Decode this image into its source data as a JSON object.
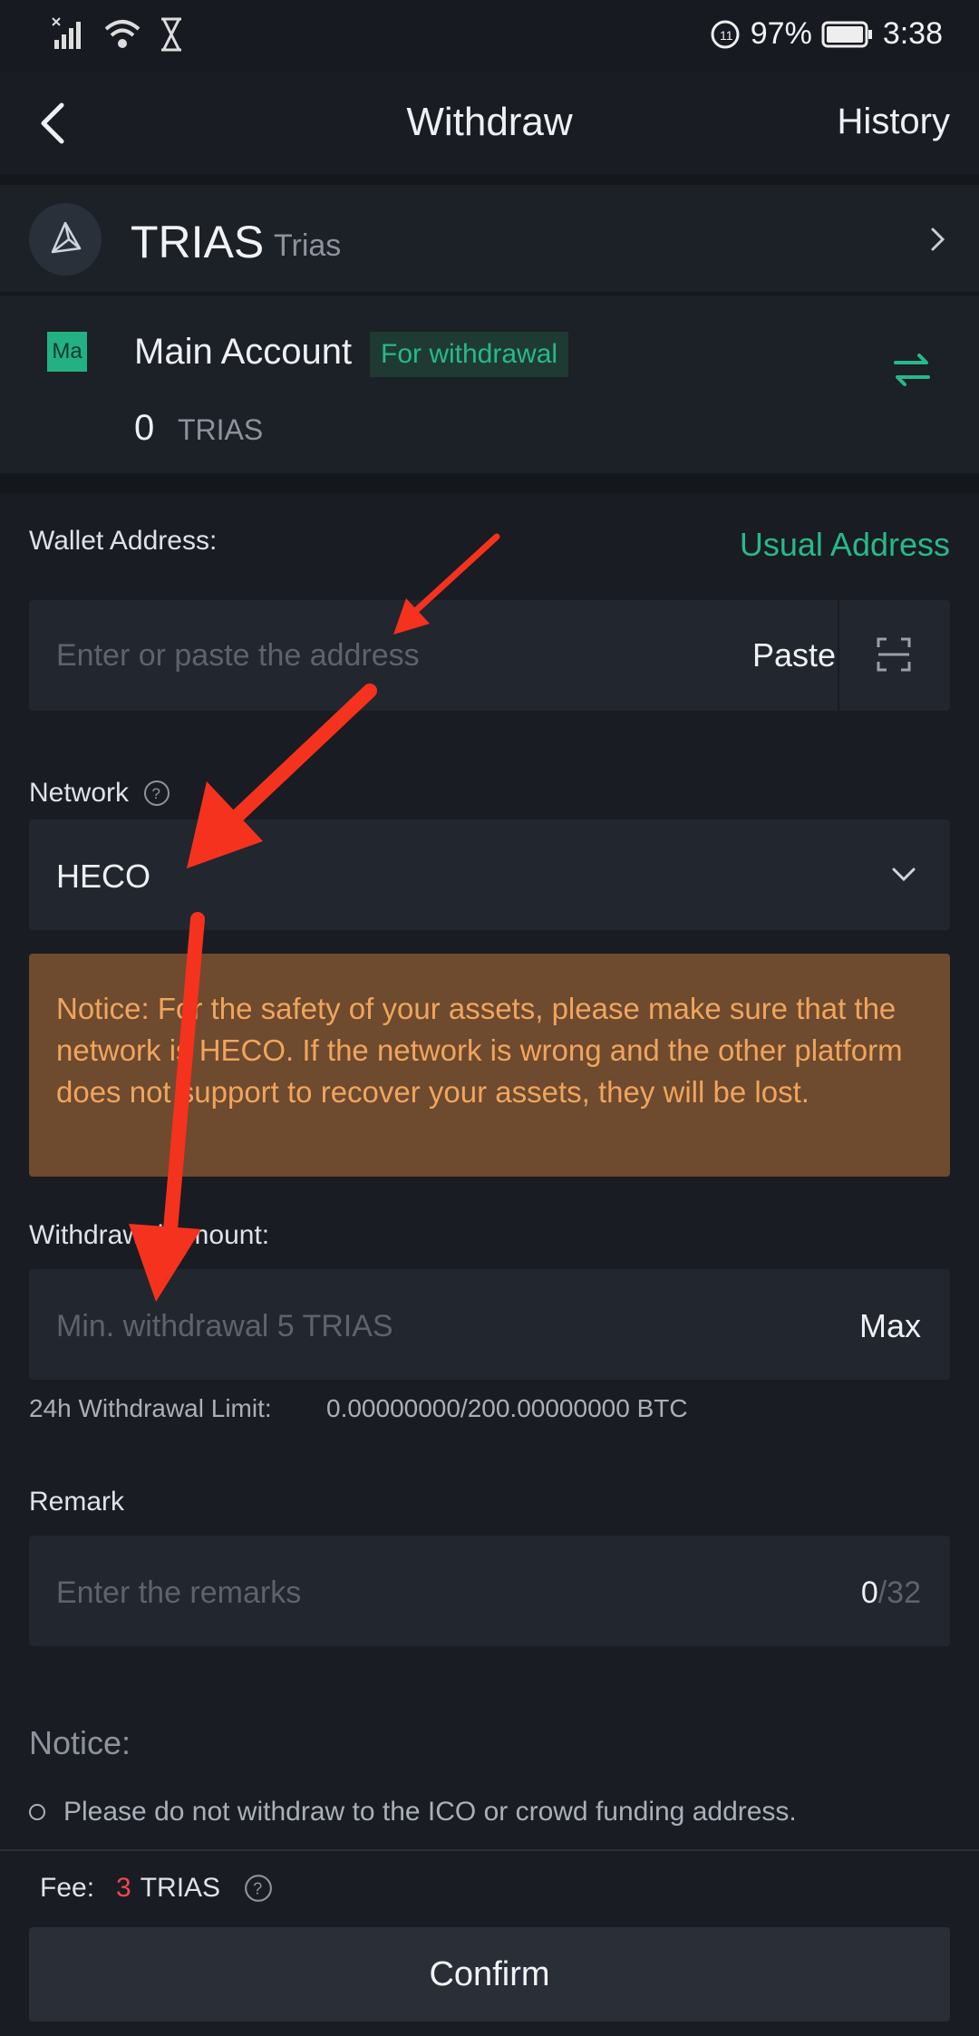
{
  "status_bar": {
    "battery": "97%",
    "time": "3:38"
  },
  "header": {
    "title": "Withdraw",
    "history": "History"
  },
  "coin": {
    "symbol": "TRIAS",
    "name": "Trias"
  },
  "account": {
    "badge": "Ma",
    "name": "Main Account",
    "tag": "For withdrawal",
    "balance": "0",
    "unit": "TRIAS"
  },
  "address": {
    "label": "Wallet Address:",
    "usual": "Usual Address",
    "placeholder": "Enter or paste the address",
    "paste": "Paste"
  },
  "network": {
    "label": "Network",
    "value": "HECO"
  },
  "notice_box": {
    "text": "Notice: For the safety of your assets, please make sure that the network is HECO. If the network is wrong and the other platform does not support to recover your assets, they will be lost."
  },
  "amount": {
    "label": "Withdrawal amount:",
    "placeholder": "Min. withdrawal 5 TRIAS",
    "max": "Max",
    "limit_label": "24h Withdrawal Limit:",
    "limit_value": "0.00000000/200.00000000 BTC"
  },
  "remark": {
    "label": "Remark",
    "placeholder": "Enter the remarks",
    "count": "0",
    "max": "/32"
  },
  "notice": {
    "title": "Notice:",
    "item": "Please do not withdraw to the ICO or crowd funding address."
  },
  "fee": {
    "label": "Fee:",
    "amount": "3",
    "unit": "TRIAS"
  },
  "confirm": "Confirm",
  "colors": {
    "accent_green": "#27b98a",
    "notice_text": "#f0a55d",
    "fee_red": "#f0474f",
    "arrow_red": "#f5321e"
  }
}
